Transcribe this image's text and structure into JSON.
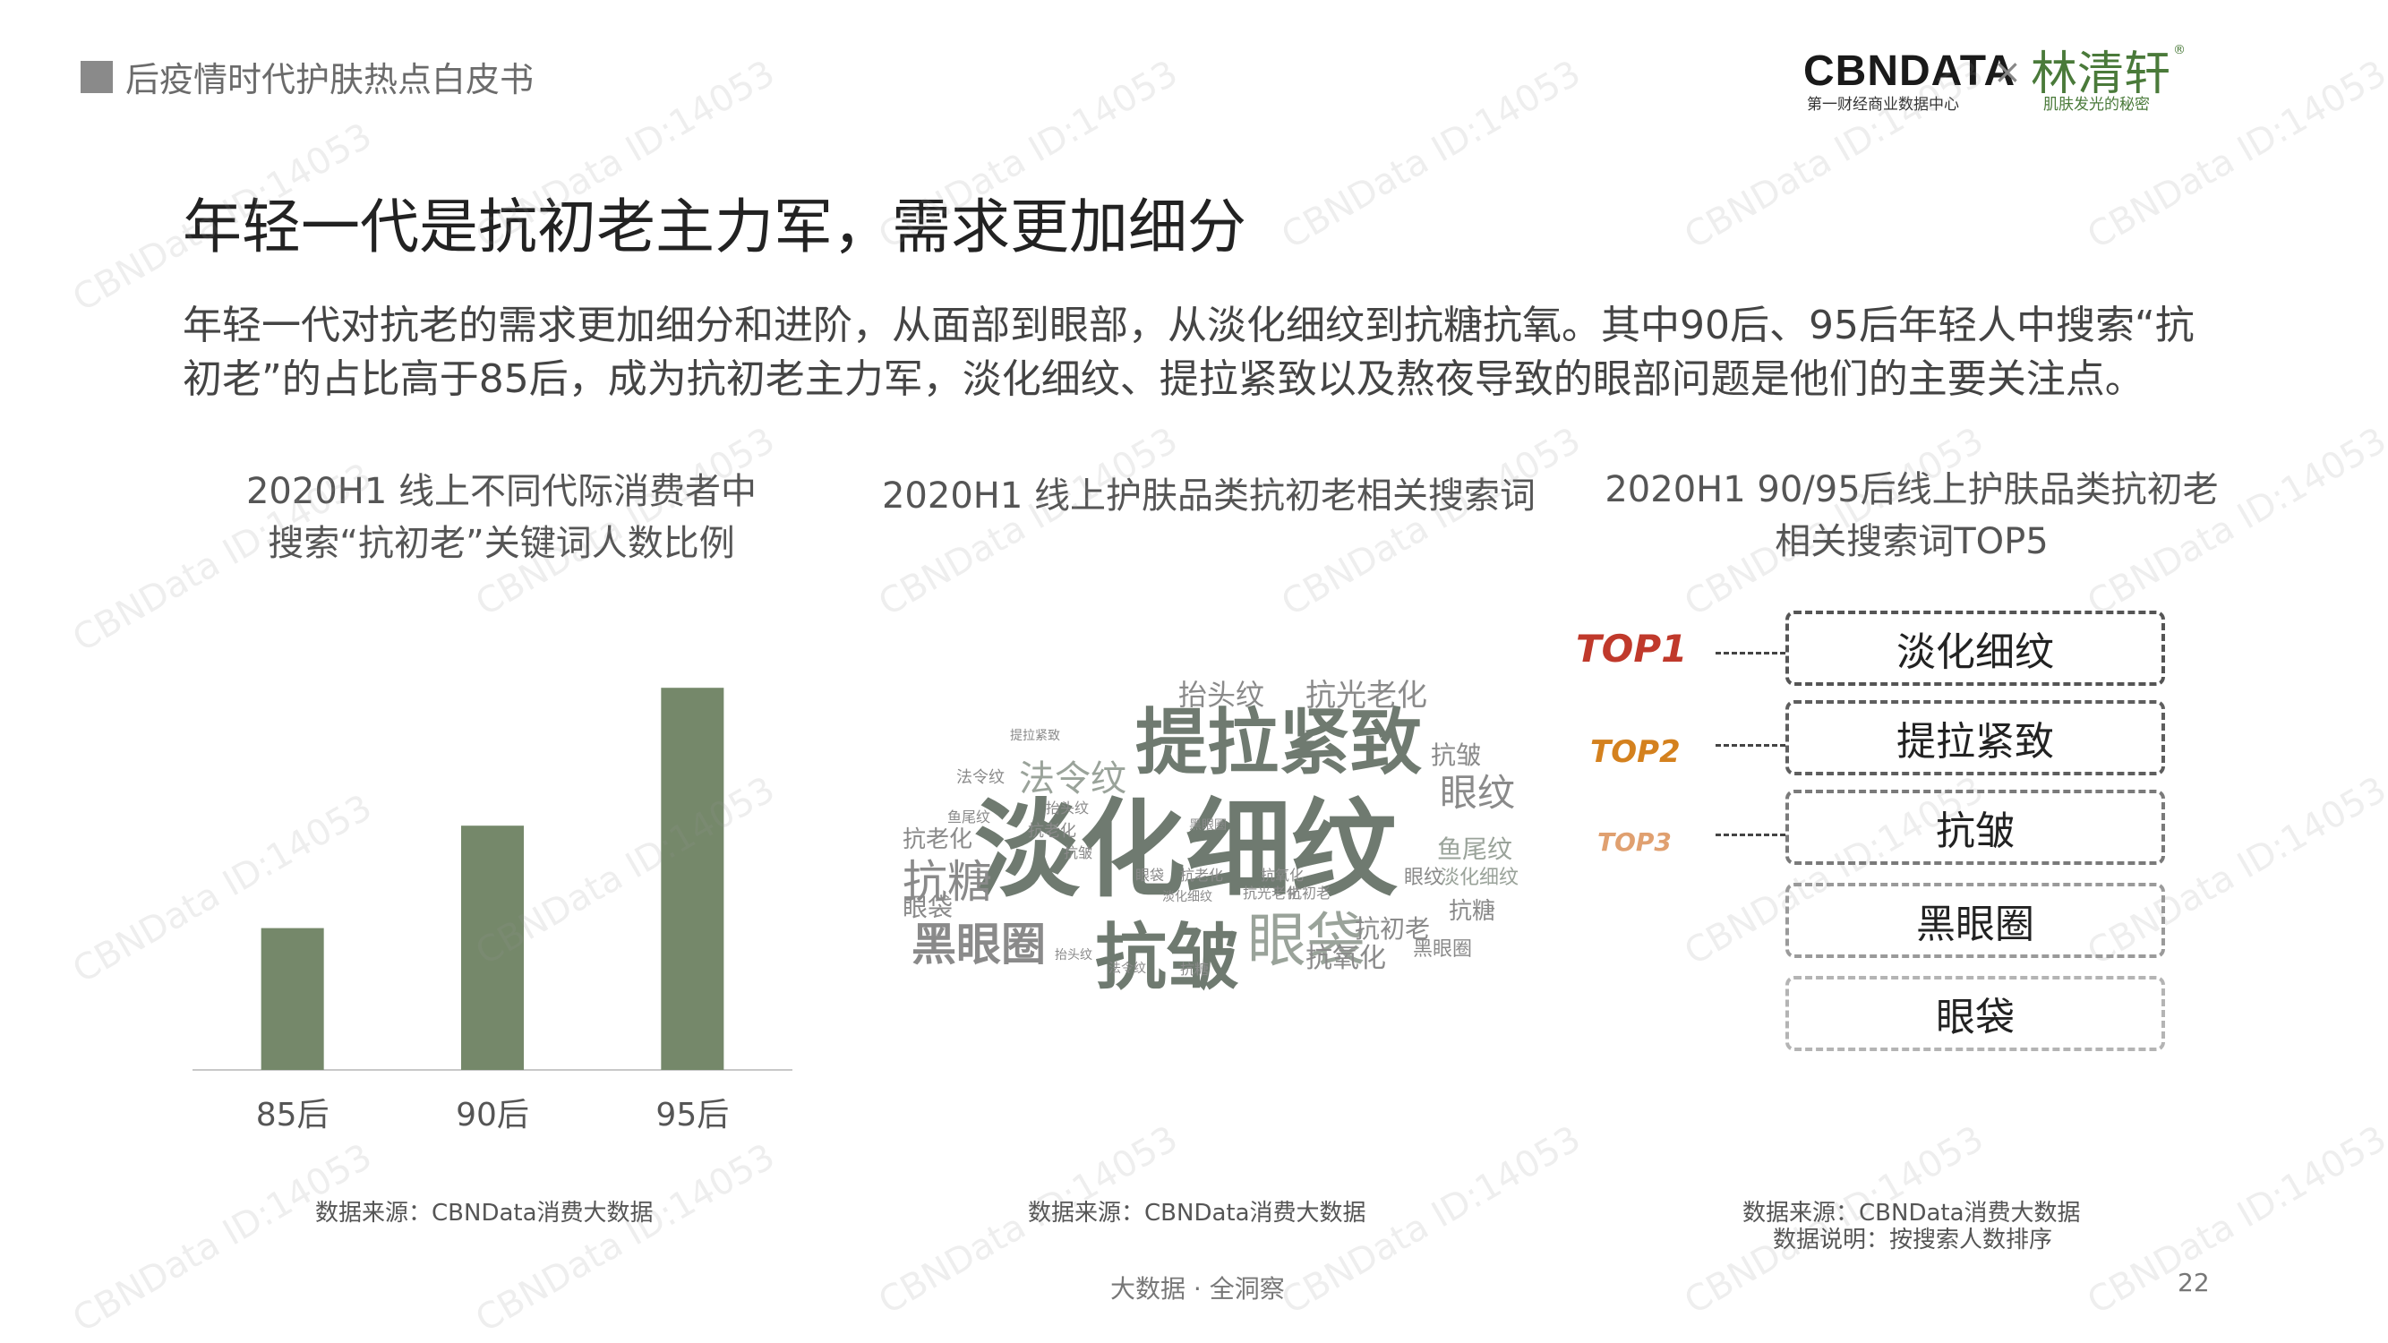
{
  "header": {
    "report_title": "后疫情时代护肤热点白皮书",
    "logo_cbndata": "CBNDATA",
    "logo_cbndata_sub": "第一财经商业数据中心",
    "logo_times": "×",
    "logo_linqingxuan": "林清轩",
    "logo_linqingxuan_sub": "肌肤发光的秘密",
    "logo_reg": "®"
  },
  "title": "年轻一代是抗初老主力军，需求更加细分",
  "description": "年轻一代对抗老的需求更加细分和进阶，从面部到眼部，从淡化细纹到抗糖抗氧。其中90后、95后年轻人中搜索“抗初老”的占比高于85后，成为抗初老主力军，淡化细纹、提拉紧致以及熬夜导致的眼部问题是他们的主要关注点。",
  "columns": {
    "c1_title_line1": "2020H1 线上不同代际消费者中",
    "c1_title_line2": "搜索“抗初老”关键词人数比例",
    "c2_title": "2020H1 线上护肤品类抗初老相关搜索词",
    "c3_title_line1": "2020H1 90/95后线上护肤品类抗初老",
    "c3_title_line2": "相关搜索词TOP5"
  },
  "chart_data": {
    "type": "bar",
    "categories": [
      "85后",
      "90后",
      "95后"
    ],
    "values": [
      0.36,
      0.62,
      0.97
    ],
    "ylim": [
      0,
      1
    ],
    "colors": {
      "bar": "#75886a",
      "axis": "#c8c8c8"
    },
    "grid": false
  },
  "wordcloud": {
    "colors": [
      "#8a8a8a",
      "#6f7a70",
      "#9aa39a"
    ],
    "words": [
      {
        "text": "淡化细纹",
        "size": 118,
        "weight": "bold",
        "color": 1
      },
      {
        "text": "提拉紧致",
        "size": 80,
        "weight": "bold",
        "color": 1
      },
      {
        "text": "抗皱",
        "size": 80,
        "weight": "bold",
        "color": 1
      },
      {
        "text": "黑眼圈",
        "size": 50,
        "weight": "bold",
        "color": 0
      },
      {
        "text": "眼袋",
        "size": 66,
        "weight": "normal",
        "color": 2
      },
      {
        "text": "抗糖",
        "size": 50,
        "weight": "normal",
        "color": 0
      },
      {
        "text": "法令纹",
        "size": 40,
        "weight": "normal",
        "color": 2
      },
      {
        "text": "眼纹",
        "size": 42,
        "weight": "normal",
        "color": 0
      },
      {
        "text": "抬头纹",
        "size": 32,
        "weight": "normal",
        "color": 0
      },
      {
        "text": "抗光老化",
        "size": 34,
        "weight": "normal",
        "color": 0
      },
      {
        "text": "抗氧化",
        "size": 30,
        "weight": "normal",
        "color": 0
      },
      {
        "text": "抗初老",
        "size": 28,
        "weight": "normal",
        "color": 0
      },
      {
        "text": "鱼尾纹",
        "size": 28,
        "weight": "normal",
        "color": 2
      },
      {
        "text": "淡化细纹",
        "size": 22,
        "weight": "normal",
        "color": 2
      },
      {
        "text": "抗老化",
        "size": 26,
        "weight": "normal",
        "color": 0
      },
      {
        "text": "眼纹",
        "size": 22,
        "weight": "normal",
        "color": 0
      },
      {
        "text": "抗皱",
        "size": 28,
        "weight": "normal",
        "color": 0
      },
      {
        "text": "抗糖",
        "size": 26,
        "weight": "normal",
        "color": 0
      },
      {
        "text": "黑眼圈",
        "size": 22,
        "weight": "normal",
        "color": 0
      },
      {
        "text": "眼袋",
        "size": 28,
        "weight": "normal",
        "color": 0
      },
      {
        "text": "法令纹",
        "size": 18,
        "weight": "normal",
        "color": 0
      },
      {
        "text": "鱼尾纹",
        "size": 16,
        "weight": "normal",
        "color": 0
      },
      {
        "text": "抗老化",
        "size": 18,
        "weight": "normal",
        "color": 0
      },
      {
        "text": "抬头纹",
        "size": 16,
        "weight": "normal",
        "color": 0
      },
      {
        "text": "抗皱",
        "size": 16,
        "weight": "normal",
        "color": 0
      },
      {
        "text": "抗老化",
        "size": 16,
        "weight": "normal",
        "color": 0
      },
      {
        "text": "眼袋",
        "size": 16,
        "weight": "normal",
        "color": 0
      },
      {
        "text": "抗氧化",
        "size": 16,
        "weight": "normal",
        "color": 0
      },
      {
        "text": "抗光老化",
        "size": 16,
        "weight": "normal",
        "color": 0
      },
      {
        "text": "抗初老",
        "size": 16,
        "weight": "normal",
        "color": 0
      },
      {
        "text": "淡化细纹",
        "size": 14,
        "weight": "normal",
        "color": 0
      },
      {
        "text": "黑眼圈",
        "size": 14,
        "weight": "normal",
        "color": 0
      },
      {
        "text": "抗糖",
        "size": 16,
        "weight": "normal",
        "color": 0
      },
      {
        "text": "提拉紧致",
        "size": 14,
        "weight": "normal",
        "color": 0
      },
      {
        "text": "抬头纹",
        "size": 14,
        "weight": "normal",
        "color": 0
      },
      {
        "text": "法令纹",
        "size": 14,
        "weight": "normal",
        "color": 0
      }
    ]
  },
  "top5": {
    "ranks": [
      "TOP1",
      "TOP2",
      "TOP3"
    ],
    "items": [
      "淡化细纹",
      "提拉紧致",
      "抗皱",
      "黑眼圈",
      "眼袋"
    ]
  },
  "sources": {
    "c1": "数据来源：CBNData消费大数据",
    "c2": "数据来源：CBNData消费大数据",
    "c3_line1": "数据来源：CBNData消费大数据",
    "c3_line2": "数据说明：按搜索人数排序"
  },
  "footer": {
    "tagline": "大数据 · 全洞察",
    "page_number": "22"
  },
  "watermark": "CBNData ID:14053"
}
